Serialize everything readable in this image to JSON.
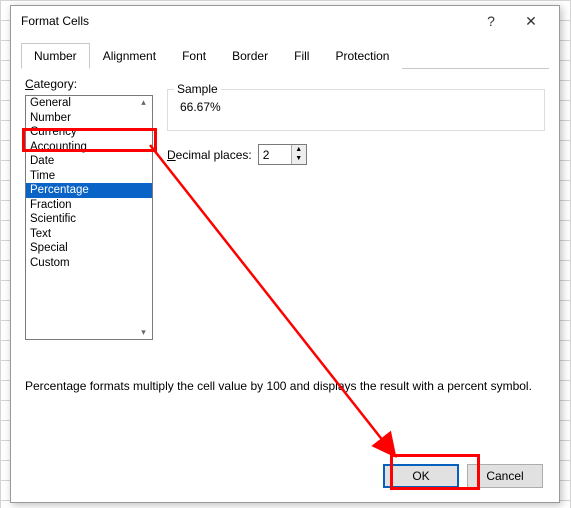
{
  "dialog": {
    "title": "Format Cells",
    "help_tip": "?",
    "close_tip": "✕"
  },
  "tabs": [
    {
      "label": "Number"
    },
    {
      "label": "Alignment"
    },
    {
      "label": "Font"
    },
    {
      "label": "Border"
    },
    {
      "label": "Fill"
    },
    {
      "label": "Protection"
    }
  ],
  "category": {
    "label_pre": "C",
    "label_post": "ategory:",
    "items": [
      "General",
      "Number",
      "Currency",
      "Accounting",
      "Date",
      "Time",
      "Percentage",
      "Fraction",
      "Scientific",
      "Text",
      "Special",
      "Custom"
    ],
    "selected_index": 6
  },
  "sample": {
    "group_title": "Sample",
    "value": "66.67%"
  },
  "decimal": {
    "label_pre": "D",
    "label_post": "ecimal places:",
    "value": "2"
  },
  "description": "Percentage formats multiply the cell value by 100 and displays the result with a percent symbol.",
  "buttons": {
    "ok": "OK",
    "cancel": "Cancel"
  }
}
